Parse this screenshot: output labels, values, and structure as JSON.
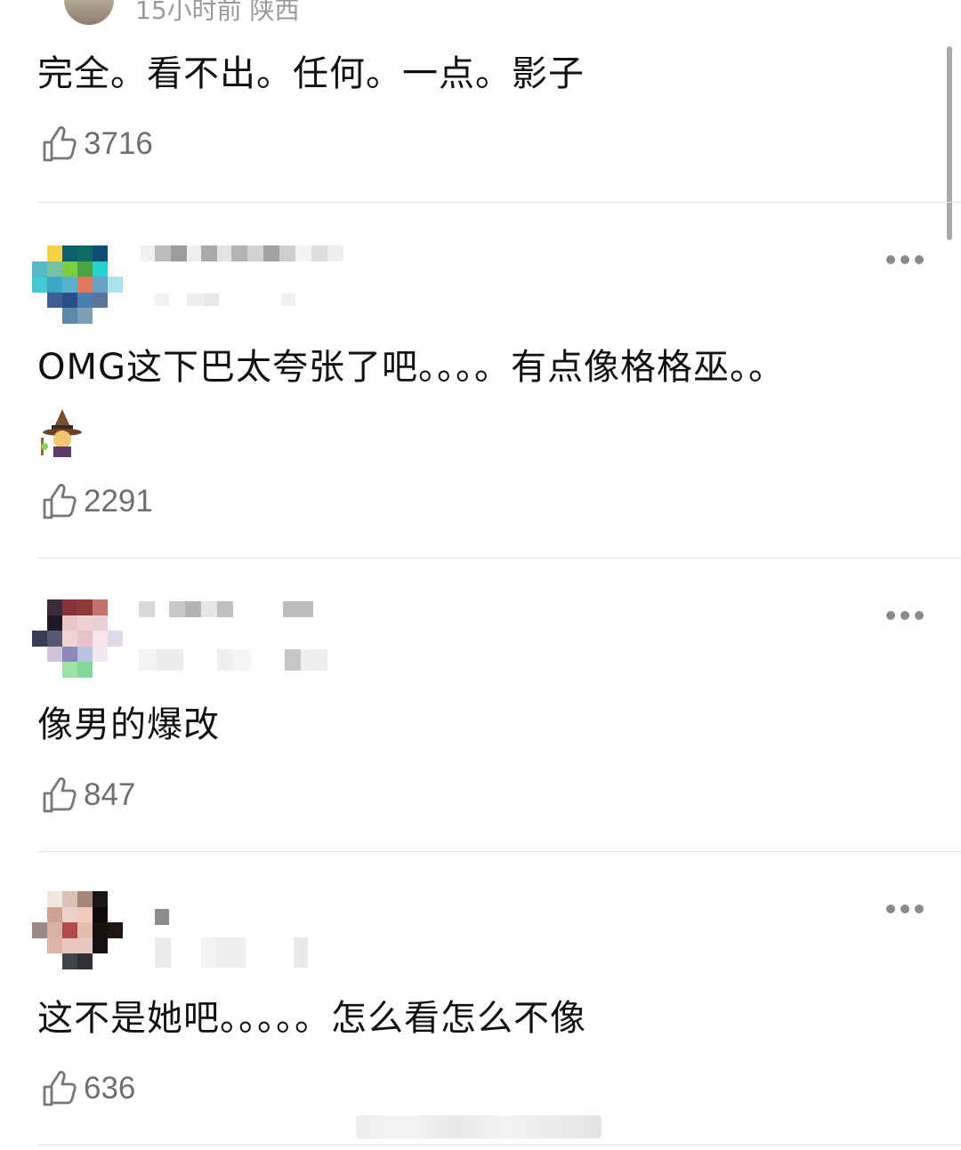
{
  "top": {
    "meta": "15小时前 陕西"
  },
  "comments": [
    {
      "text": "完全。看不出。任何。一点。影子",
      "likes": "3716"
    },
    {
      "text": "OMG这下巴太夸张了吧。。。。有点像格格巫。。",
      "emoji": "witch-emoji",
      "likes": "2291"
    },
    {
      "text": "像男的爆改",
      "likes": "847"
    },
    {
      "text": "这不是她吧。。。。。怎么看怎么不像",
      "likes": "636"
    }
  ],
  "colors": {
    "text": "#111111",
    "muted": "#6f6f6f",
    "divider": "#e3e3e3"
  }
}
